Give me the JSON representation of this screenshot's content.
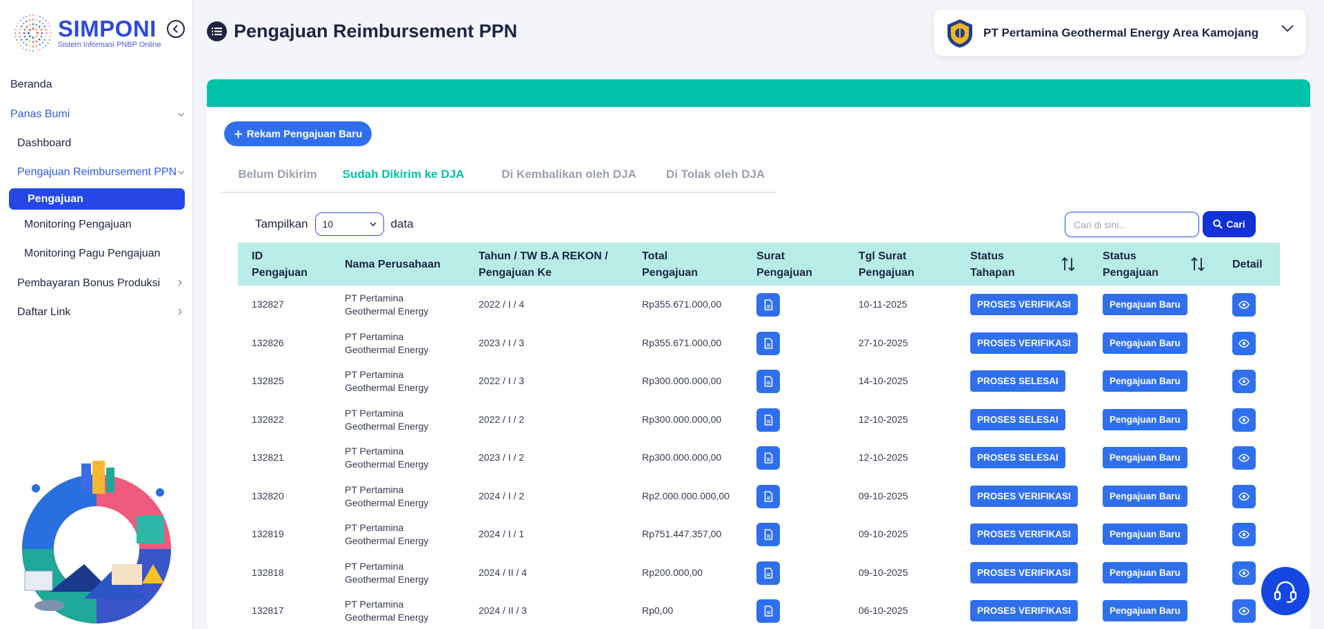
{
  "app": {
    "logo_title": "SIMPONI",
    "logo_subtitle": "Sistem Informasi PNBP Online"
  },
  "sidebar": {
    "items": [
      {
        "label": "Beranda"
      },
      {
        "label": "Panas Bumi"
      },
      {
        "label": "Dashboard"
      },
      {
        "label": "Pengajuan Reimbursement PPN"
      },
      {
        "label": "Pengajuan"
      },
      {
        "label": "Monitoring Pengajuan"
      },
      {
        "label": "Monitoring Pagu Pengajuan"
      },
      {
        "label": "Pembayaran Bonus Produksi"
      },
      {
        "label": "Daftar Link"
      }
    ]
  },
  "header": {
    "title": "Pengajuan Reimbursement PPN",
    "company": "PT Pertamina Geothermal Energy Area Kamojang"
  },
  "main": {
    "new_button": "Rekam Pengajuan Baru",
    "tabs": [
      {
        "label": "Belum Dikirim"
      },
      {
        "label": "Sudah Dikirim ke DJA"
      },
      {
        "label": "Di Kembalikan oleh DJA"
      },
      {
        "label": "Di Tolak oleh DJA"
      }
    ],
    "active_tab": "Sudah Dikirim ke DJA",
    "show_label": "Tampilkan",
    "show_value": "10",
    "show_suffix": "data",
    "search_placeholder": "Cari di sini...",
    "search_button": "Cari"
  },
  "table": {
    "headers": {
      "id": [
        "ID",
        "Pengajuan"
      ],
      "company": [
        "Nama Perusahaan"
      ],
      "period": [
        "Tahun / TW B.A REKON /",
        "Pengajuan Ke"
      ],
      "total": [
        "Total",
        "Pengajuan"
      ],
      "letter": [
        "Surat",
        "Pengajuan"
      ],
      "date": [
        "Tgl Surat",
        "Pengajuan"
      ],
      "stage": [
        "Status",
        "Tahapan"
      ],
      "status": [
        "Status",
        "Pengajuan"
      ],
      "detail": [
        "Detail"
      ]
    },
    "rows": [
      {
        "id": "132827",
        "company_1": "PT Pertamina",
        "company_2": "Geothermal Energy",
        "period": "2022 / I / 4",
        "total": "Rp355.671.000,00",
        "date": "10-11-2025",
        "stage": "PROSES VERIFIKASI",
        "status": "Pengajuan Baru"
      },
      {
        "id": "132826",
        "company_1": "PT Pertamina",
        "company_2": "Geothermal Energy",
        "period": "2023 / I / 3",
        "total": "Rp355.671.000,00",
        "date": "27-10-2025",
        "stage": "PROSES VERIFIKASI",
        "status": "Pengajuan Baru"
      },
      {
        "id": "132825",
        "company_1": "PT Pertamina",
        "company_2": "Geothermal Energy",
        "period": "2022 / I / 3",
        "total": "Rp300.000.000,00",
        "date": "14-10-2025",
        "stage": "PROSES SELESAI",
        "status": "Pengajuan Baru"
      },
      {
        "id": "132822",
        "company_1": "PT Pertamina",
        "company_2": "Geothermal Energy",
        "period": "2022 / I / 2",
        "total": "Rp300.000.000,00",
        "date": "12-10-2025",
        "stage": "PROSES SELESAI",
        "status": "Pengajuan Baru"
      },
      {
        "id": "132821",
        "company_1": "PT Pertamina",
        "company_2": "Geothermal Energy",
        "period": "2023 / I / 2",
        "total": "Rp300.000.000,00",
        "date": "12-10-2025",
        "stage": "PROSES SELESAI",
        "status": "Pengajuan Baru"
      },
      {
        "id": "132820",
        "company_1": "PT Pertamina",
        "company_2": "Geothermal Energy",
        "period": "2024 / I / 2",
        "total": "Rp2.000.000.000,00",
        "date": "09-10-2025",
        "stage": "PROSES VERIFIKASI",
        "status": "Pengajuan Baru"
      },
      {
        "id": "132819",
        "company_1": "PT Pertamina",
        "company_2": "Geothermal Energy",
        "period": "2024 / I / 1",
        "total": "Rp751.447.357,00",
        "date": "09-10-2025",
        "stage": "PROSES VERIFIKASI",
        "status": "Pengajuan Baru"
      },
      {
        "id": "132818",
        "company_1": "PT Pertamina",
        "company_2": "Geothermal Energy",
        "period": "2024 / II / 4",
        "total": "Rp200.000,00",
        "date": "09-10-2025",
        "stage": "PROSES VERIFIKASI",
        "status": "Pengajuan Baru"
      },
      {
        "id": "132817",
        "company_1": "PT Pertamina",
        "company_2": "Geothermal Energy",
        "period": "2024 / II / 3",
        "total": "Rp0,00",
        "date": "06-10-2025",
        "stage": "PROSES VERIFIKASI",
        "status": "Pengajuan Baru"
      }
    ]
  },
  "icons": {
    "header": "list-icon",
    "search": "search-icon",
    "letter": "pdf-file-icon",
    "detail": "eye-icon",
    "help": "headset-icon"
  },
  "colors": {
    "primary": "#2f6fee",
    "accent_teal": "#00c2a8",
    "navy": "#1c2541",
    "header_row": "#b8ece6"
  }
}
